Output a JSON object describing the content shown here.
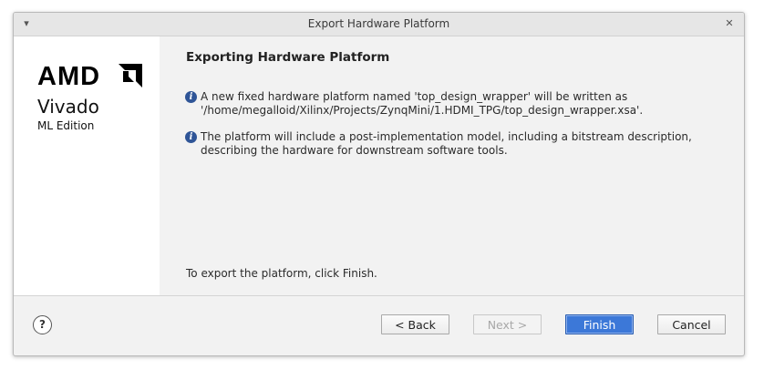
{
  "window": {
    "title": "Export Hardware Platform",
    "collapse_glyph": "▾",
    "close_glyph": "✕"
  },
  "brand": {
    "company": "AMD",
    "product": "Vivado",
    "edition": "ML Edition"
  },
  "page": {
    "heading": "Exporting Hardware Platform",
    "info_items": [
      {
        "line1": "A new fixed hardware platform named 'top_design_wrapper' will be written as",
        "line2": "'/home/megalloid/Xilinx/Projects/ZynqMini/1.HDMI_TPG/top_design_wrapper.xsa'."
      },
      {
        "line1": "The platform will include a post-implementation model, including a bitstream description,",
        "line2": "describing the hardware for downstream software tools."
      }
    ],
    "footer_note": "To export the platform, click Finish."
  },
  "buttons": {
    "help": "?",
    "back": "< Back",
    "next": "Next >",
    "finish": "Finish",
    "cancel": "Cancel"
  },
  "colors": {
    "primary_button": "#3c78d8",
    "info_icon": "#2f5597"
  }
}
